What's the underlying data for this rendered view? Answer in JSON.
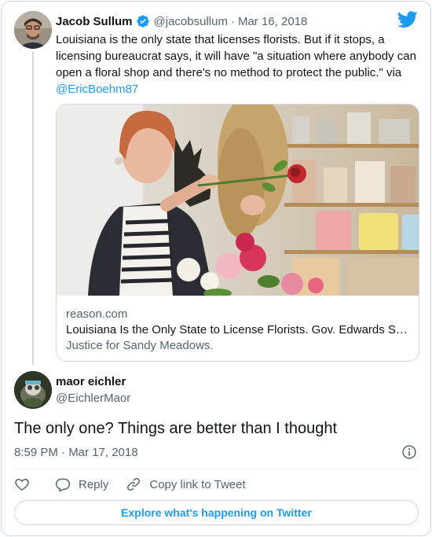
{
  "parent_tweet": {
    "author_name": "Jacob Sullum",
    "author_handle": "@jacobsullum",
    "separator": "·",
    "date": "Mar 16, 2018",
    "text": "Louisiana is the only state that licenses florists. But if it stops, a licensing bureaucrat says, it will have \"a situation where anybody can open a floral shop and there's no method to protect the public.\" via",
    "mention": "@EricBoehm87",
    "card": {
      "domain": "reason.com",
      "title": "Louisiana Is the Only State to License Florists. Gov. Edwards Says Getting Rid of Those Licenses Would Be Dangerous.",
      "description": "Justice for Sandy Meadows."
    }
  },
  "reply_tweet": {
    "author_name": "maor eichler",
    "author_handle": "@EichlerMaor",
    "text": "The only one? Things are better than I thought",
    "timestamp": "8:59 PM · Mar 17, 2018"
  },
  "actions": {
    "reply_label": "Reply",
    "copy_link_label": "Copy link to Tweet"
  },
  "explore_label": "Explore what's happening on Twitter",
  "colors": {
    "accent": "#1d9bf0",
    "text_primary": "#0f1419",
    "text_secondary": "#536471",
    "border": "#cfd9de"
  },
  "icons": [
    "verified-badge-icon",
    "twitter-bird-icon",
    "info-icon",
    "heart-icon",
    "reply-bubble-icon",
    "link-icon"
  ]
}
